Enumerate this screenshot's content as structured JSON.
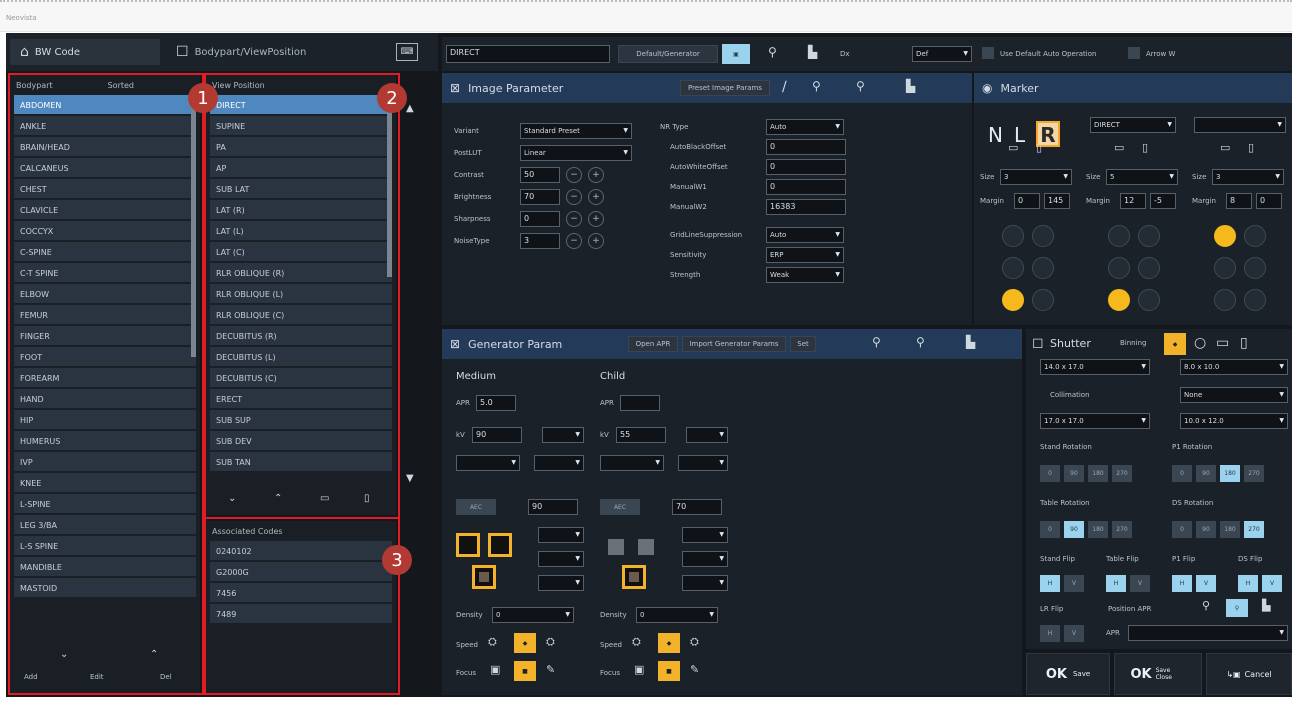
{
  "window": {
    "title": "Neovista"
  },
  "tabs": {
    "bw_code": "BW Code",
    "body_part": "Bodypart/ViewPosition"
  },
  "bodypart_list": {
    "header_left": "Bodypart",
    "header_right": "Sorted",
    "items": [
      "ABDOMEN",
      "ANKLE",
      "BRAIN/HEAD",
      "CALCANEUS",
      "CHEST",
      "CLAVICLE",
      "COCCYX",
      "C-SPINE",
      "C-T SPINE",
      "ELBOW",
      "FEMUR",
      "FINGER",
      "FOOT",
      "FOREARM",
      "HAND",
      "HIP",
      "HUMERUS",
      "IVP",
      "KNEE",
      "L-SPINE",
      "LEG 3/BA",
      "L-S SPINE",
      "MANDIBLE",
      "MASTOID"
    ],
    "selected": "ABDOMEN",
    "footer": [
      "Add",
      "Edit",
      "Del"
    ]
  },
  "view_list": {
    "header": "View Position",
    "items": [
      "DIRECT",
      "SUPINE",
      "PA",
      "AP",
      "SUB LAT",
      "LAT (R)",
      "LAT (L)",
      "LAT (C)",
      "RLR OBLIQUE (R)",
      "RLR OBLIQUE (L)",
      "RLR OBLIQUE (C)",
      "DECUBITUS (R)",
      "DECUBITUS (L)",
      "DECUBITUS (C)",
      "ERECT",
      "SUB SUP",
      "SUB DEV",
      "SUB TAN"
    ],
    "selected": "DIRECT"
  },
  "assoc_list": {
    "header": "Associated Codes",
    "items": [
      "0240102",
      "G2000G",
      "7456",
      "7489"
    ]
  },
  "markers": [
    "1",
    "2",
    "3"
  ],
  "toolbar": {
    "field": "DIRECT",
    "btn1": "Default/Generator",
    "dd1_label": "Dx",
    "dd1": "Def",
    "auto_label": "Use Default Auto Operation",
    "auto2": "Arrow W"
  },
  "image_params": {
    "title": "Image Parameter",
    "btn": "Preset Image Params",
    "left": [
      {
        "label": "Variant",
        "value": "Standard Preset",
        "type": "dd"
      },
      {
        "label": "PostLUT",
        "value": "Linear",
        "type": "dd"
      },
      {
        "label": "Contrast",
        "value": "50",
        "type": "num"
      },
      {
        "label": "Brightness",
        "value": "70",
        "type": "num"
      },
      {
        "label": "Sharpness",
        "value": "0",
        "type": "num"
      },
      {
        "label": "NoiseType",
        "value": "3",
        "type": "num"
      }
    ],
    "right": [
      {
        "label": "NR Type",
        "value": "Auto",
        "type": "dd"
      },
      {
        "label": "AutoBlackOffset",
        "value": "0",
        "type": "f"
      },
      {
        "label": "AutoWhiteOffset",
        "value": "0",
        "type": "f"
      },
      {
        "label": "ManualW1",
        "value": "0",
        "type": "f"
      },
      {
        "label": "ManualW2",
        "value": "16383",
        "type": "f"
      },
      {
        "label": "GridLineSuppression",
        "value": "Auto",
        "type": "dd"
      },
      {
        "label": "Sensitivity",
        "value": "ERP",
        "type": "dd"
      },
      {
        "label": "Strength",
        "value": "Weak",
        "type": "dd"
      }
    ]
  },
  "marker_panel": {
    "title": "Marker",
    "letters": [
      "N",
      "L",
      "R"
    ],
    "dd1": "DIRECT",
    "dd2": "",
    "size_label": "Size",
    "margin_label": "Margin",
    "size_values": [
      "3",
      "5",
      "3"
    ],
    "margin_values": [
      [
        "0",
        "145"
      ],
      [
        "12",
        "-5"
      ],
      [
        "8",
        "0"
      ]
    ]
  },
  "generator": {
    "title": "Generator Param",
    "buttons": [
      "Open APR",
      "Import Generator Params",
      "Set"
    ],
    "medium": "Medium",
    "child": "Child",
    "kvp_label": "kV",
    "mas_label": "mAs",
    "density_label": "Density",
    "speed_label": "Speed",
    "focus_label": "Focus",
    "apr": "APR",
    "apr_val": "5.0",
    "m_kv": "90",
    "c_kv": "55",
    "m_aec": "AEC",
    "m_kv2": "90",
    "c_kv2": "70",
    "m_density": "0",
    "c_density": "0"
  },
  "shutter": {
    "title": "Shutter",
    "title2": "Binning",
    "dd1": "14.0 x 17.0",
    "dd2": "8.0 x 10.0",
    "collimation": "Collimation",
    "dd3": "17.0 x 17.0",
    "dd4": "10.0 x 12.0",
    "dd5": "None",
    "stand_rotation": "Stand Rotation",
    "p1_rotation": "P1 Rotation",
    "table_rotation": "Table Rotation",
    "ds_rotation": "DS Rotation",
    "rot_values": [
      "0",
      "90",
      "180",
      "270"
    ],
    "flips": [
      "Stand Flip",
      "Table Flip",
      "P1 Flip",
      "DS Flip"
    ],
    "flip_h": "H",
    "flip_v": "V",
    "lr_flip": "LR Flip",
    "position": "Position APR",
    "apr_label": "APR"
  },
  "ok": {
    "ok": "OK",
    "ok_sub": "Save",
    "ok2": "OK",
    "ok2_sub": "Save Close",
    "cancel": "Cancel"
  }
}
